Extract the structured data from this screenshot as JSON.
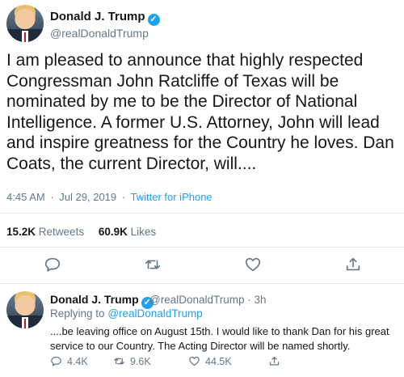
{
  "main_tweet": {
    "author_name": "Donald J. Trump",
    "handle": "@realDonaldTrump",
    "text": "I am pleased to announce that highly respected Congressman John Ratcliffe of Texas will be nominated by me to be the Director of National Intelligence. A former U.S. Attorney, John will lead and inspire greatness for the Country he loves. Dan Coats, the current Director, will....",
    "time": "4:45 AM",
    "date": "Jul 29, 2019",
    "separator": "·",
    "source": "Twitter for iPhone",
    "retweets_count": "15.2K",
    "retweets_label": "Retweets",
    "likes_count": "60.9K",
    "likes_label": "Likes",
    "icons": [
      "reply-icon",
      "retweet-icon",
      "like-icon",
      "share-icon"
    ]
  },
  "reply_tweet": {
    "author_name": "Donald J. Trump",
    "handle": "@realDonaldTrump",
    "age": "3h",
    "separator": "·",
    "replying_label": "Replying to",
    "replying_to": "@realDonaldTrump",
    "text": "....be leaving office on August 15th. I would like to thank Dan for his great service to our Country. The Acting Director will be named shortly.",
    "reply_count": "4.4K",
    "retweet_count": "9.6K",
    "like_count": "44.5K"
  },
  "colors": {
    "accent": "#1da1f2",
    "muted": "#657786",
    "text": "#14171a",
    "divider": "#e6ecf0"
  }
}
